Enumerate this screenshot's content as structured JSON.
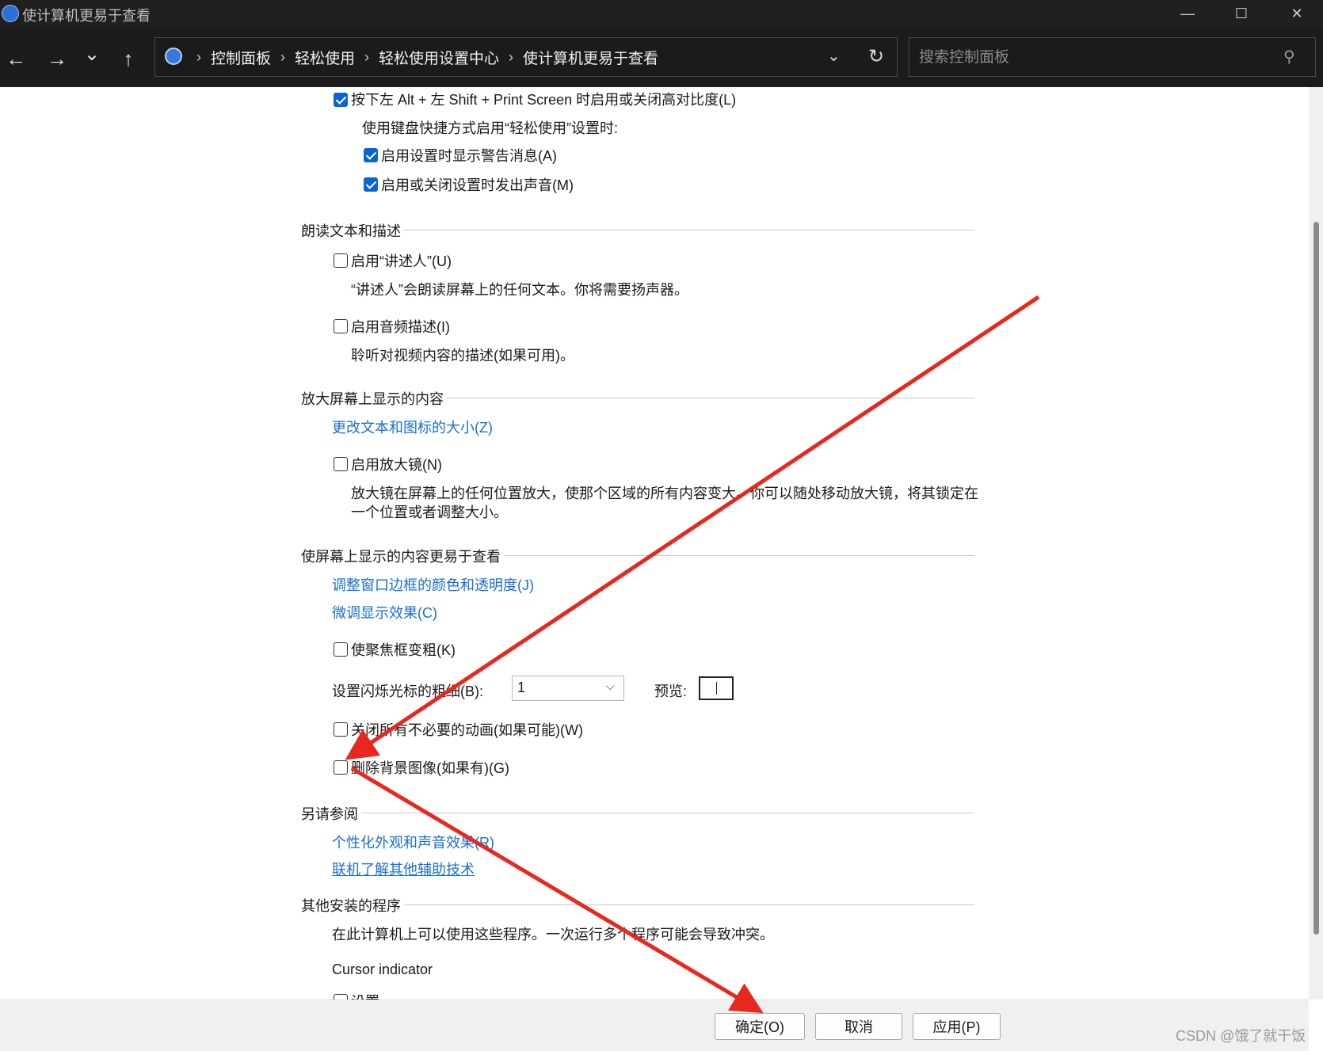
{
  "window": {
    "title": "使计算机更易于查看",
    "minimize_glyph": "—",
    "maximize_glyph": "☐",
    "close_glyph": "✕"
  },
  "nav": {
    "back_glyph": "←",
    "forward_glyph": "→",
    "recent_glyph": "⌄",
    "up_glyph": "↑",
    "breadcrumbs": [
      "控制面板",
      "轻松使用",
      "轻松使用设置中心",
      "使计算机更易于查看"
    ],
    "breadcrumb_sep": "›",
    "dropdown_glyph": "⌄",
    "refresh_glyph": "↻",
    "search_placeholder": "搜索控制面板",
    "search_glyph": "⚲"
  },
  "high_contrast": {
    "shortcut_label": "按下左 Alt + 左 Shift + Print Screen 时启用或关闭高对比度(L)",
    "shortcut_checked": true,
    "shortcut_intro": "使用键盘快捷方式启用“轻松使用”设置时:",
    "warning_label": "启用设置时显示警告消息(A)",
    "warning_checked": true,
    "sound_label": "启用或关闭设置时发出声音(M)",
    "sound_checked": true
  },
  "narration": {
    "header": "朗读文本和描述",
    "narrator_label": "启用“讲述人”(U)",
    "narrator_checked": false,
    "narrator_desc": "“讲述人”会朗读屏幕上的任何文本。你将需要扬声器。",
    "audio_desc_label": "启用音频描述(I)",
    "audio_desc_checked": false,
    "audio_desc_desc": "聆听对视频内容的描述(如果可用)。"
  },
  "magnify": {
    "header": "放大屏幕上显示的内容",
    "resize_link": "更改文本和图标的大小(Z)",
    "magnifier_label": "启用放大镜(N)",
    "magnifier_checked": false,
    "magnifier_desc_1": "放大镜在屏幕上的任何位置放大，使那个区域的所有内容变大。你可以随处移动放大镜，将其锁定在",
    "magnifier_desc_2": "一个位置或者调整大小。"
  },
  "easier_view": {
    "header": "使屏幕上显示的内容更易于查看",
    "border_link": "调整窗口边框的颜色和透明度(J)",
    "fine_tune_link": "微调显示效果(C)",
    "focus_label": "使聚焦框变粗(K)",
    "focus_checked": false,
    "cursor_width_label": "设置闪烁光标的粗细(B):",
    "cursor_width_value": "1",
    "preview_label": "预览:",
    "animations_label": "关闭所有不必要的动画(如果可能)(W)",
    "animations_checked": false,
    "background_label": "删除背景图像(如果有)(G)",
    "background_checked": false
  },
  "see_also": {
    "header": "另请参阅",
    "personalize_link": "个性化外观和声音效果(R)",
    "online_link": "联机了解其他辅助技术"
  },
  "other_programs": {
    "header": "其他安装的程序",
    "desc": "在此计算机上可以使用这些程序。一次运行多个程序可能会导致冲突。",
    "program_name": "Cursor indicator",
    "program_setting": "设置"
  },
  "buttons": {
    "ok": "确定(O)",
    "cancel": "取消",
    "apply": "应用(P)"
  },
  "watermark": "CSDN @饿了就干饭",
  "annotation_color": "#e8281e"
}
